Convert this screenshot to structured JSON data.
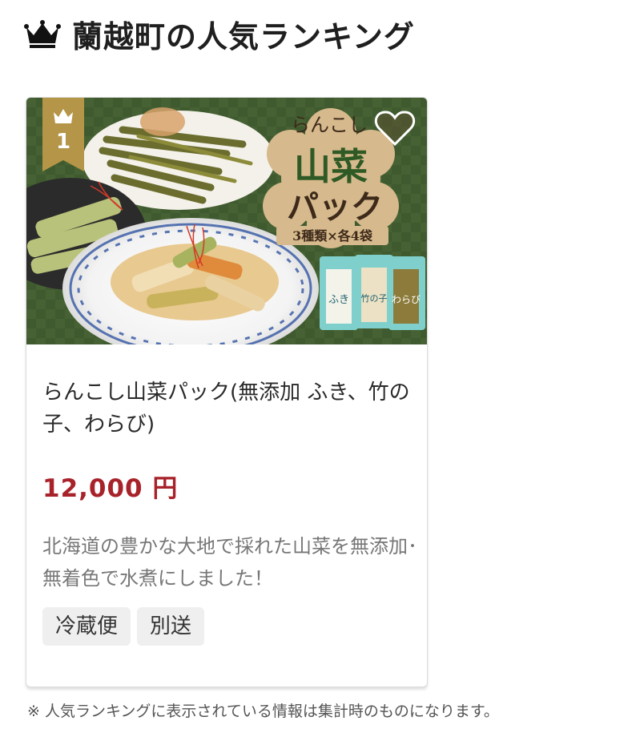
{
  "heading": {
    "icon": "crown-icon",
    "title": "蘭越町の人気ランキング"
  },
  "product": {
    "rank": "1",
    "image": {
      "badge_line1": "らんこし",
      "badge_big1": "山菜",
      "badge_big2": "パック",
      "badge_sub": "3種類×各4袋",
      "pkg1": "ふき",
      "pkg2": "竹の子",
      "pkg3": "わらび"
    },
    "title": "らんこし山菜パック(無添加 ふき、竹の子、わらび)",
    "price": "12,000 円",
    "description": "北海道の豊かな大地で採れた山菜を無添加･無着色で水煮にしました！",
    "tags": [
      "冷蔵便",
      "別送"
    ]
  },
  "footnote": "※ 人気ランキングに表示されている情報は集計時のものになります。",
  "colors": {
    "price": "#a8222a",
    "rank_badge": "#b59547",
    "image_bg": "#3f5a2e",
    "badge_bg": "#d6b98c"
  }
}
